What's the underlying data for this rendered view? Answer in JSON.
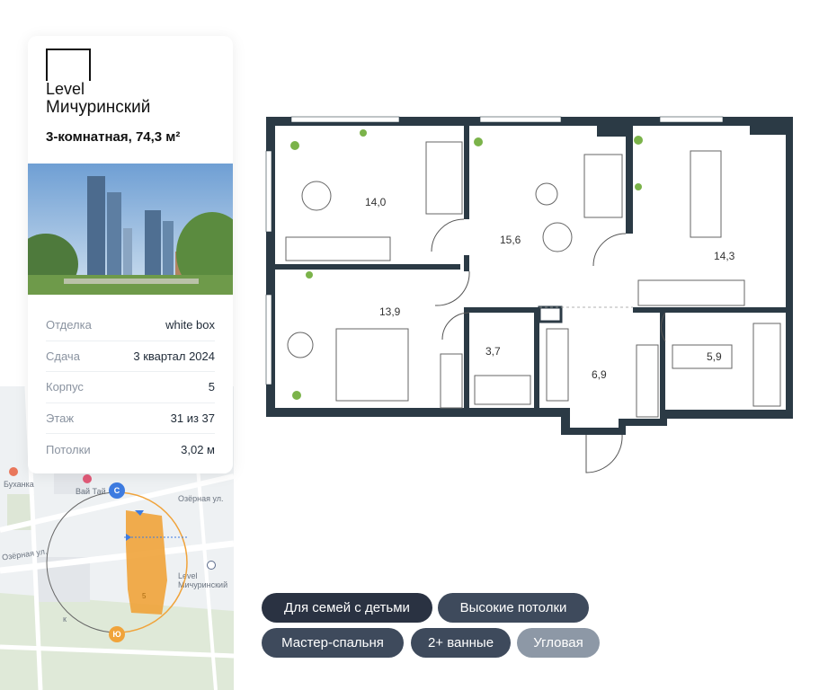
{
  "brand": {
    "name": "Level",
    "project": "Мичуринский"
  },
  "apartment": {
    "title": "3-комнатная, 74,3 м²"
  },
  "details": [
    {
      "key": "Отделка",
      "value": "white box"
    },
    {
      "key": "Сдача",
      "value": "3 квартал 2024"
    },
    {
      "key": "Корпус",
      "value": "5"
    },
    {
      "key": "Этаж",
      "value": "31 из 37"
    },
    {
      "key": "Потолки",
      "value": "3,02 м"
    }
  ],
  "map": {
    "labels": [
      "Буханка",
      "Вай Тай",
      "Озёрная ул.",
      "Озёрная ул.",
      "Level Мичуринский",
      "к"
    ],
    "compass": {
      "north": "С",
      "south": "Ю"
    },
    "building_number": "5"
  },
  "rooms": [
    {
      "name": "room-bedroom-1",
      "area": "14,0"
    },
    {
      "name": "room-living",
      "area": "15,6"
    },
    {
      "name": "room-kitchen",
      "area": "14,3"
    },
    {
      "name": "room-bedroom-master",
      "area": "13,9"
    },
    {
      "name": "room-bathroom-1",
      "area": "3,7"
    },
    {
      "name": "room-hall",
      "area": "6,9"
    },
    {
      "name": "room-bathroom-2",
      "area": "5,9"
    }
  ],
  "tags": [
    {
      "label": "Для семей с детьми",
      "color": "#2a3242"
    },
    {
      "label": "Высокие потолки",
      "color": "#3e4a5c"
    },
    {
      "label": "Мастер-спальня",
      "color": "#3e4a5c"
    },
    {
      "label": "2+ ванные",
      "color": "#3e4a5c"
    },
    {
      "label": "Угловая",
      "color": "#8d98a6"
    }
  ],
  "colors": {
    "wall": "#2b3a45",
    "accent": "#f0a33a",
    "north_badge": "#3d7be0",
    "south_badge": "#f0a33a"
  }
}
